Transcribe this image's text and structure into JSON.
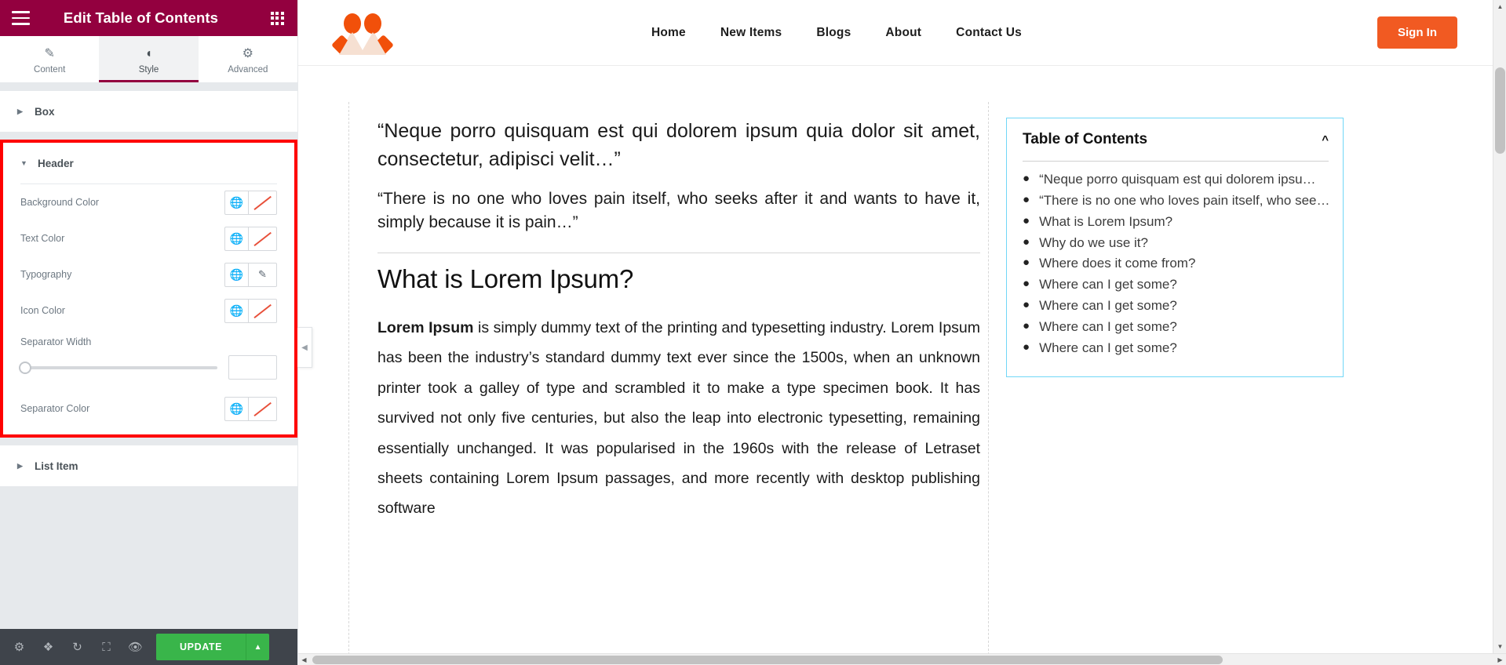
{
  "panel": {
    "title": "Edit Table of Contents",
    "menu_icon": "hamburger-icon",
    "grid_icon": "apps-grid-icon",
    "tabs": [
      {
        "label": "Content",
        "icon": "pencil-icon",
        "active": false
      },
      {
        "label": "Style",
        "icon": "contrast-icon",
        "active": true
      },
      {
        "label": "Advanced",
        "icon": "gear-icon",
        "active": false
      }
    ],
    "sections": [
      {
        "label": "Box",
        "expanded": false
      },
      {
        "label": "Header",
        "expanded": true
      },
      {
        "label": "List Item",
        "expanded": false
      }
    ],
    "header_controls": [
      {
        "label": "Background Color",
        "type": "color",
        "globe": "globe-icon",
        "swatch": "empty"
      },
      {
        "label": "Text Color",
        "type": "color",
        "globe": "globe-icon",
        "swatch": "empty"
      },
      {
        "label": "Typography",
        "type": "typography",
        "globe": "globe-icon",
        "swatch": "pencil"
      },
      {
        "label": "Icon Color",
        "type": "color",
        "globe": "globe-icon",
        "swatch": "empty"
      },
      {
        "label": "Separator Width",
        "type": "slider",
        "value": "",
        "slider_percent": 0
      },
      {
        "label": "Separator Color",
        "type": "color",
        "globe": "globe-icon",
        "swatch": "empty"
      }
    ],
    "footer": {
      "icons": [
        "gear-icon",
        "layers-icon",
        "history-icon",
        "responsive-icon",
        "preview-eye-icon"
      ],
      "update_label": "UPDATE",
      "update_caret": "chevron-up-icon"
    },
    "collapse_handle_icon": "chevron-left-icon",
    "highlight_color": "#ff0000",
    "header_bar_color": "#93003f"
  },
  "site": {
    "logo_alt": "site-logo",
    "nav": [
      "Home",
      "New Items",
      "Blogs",
      "About",
      "Contact Us"
    ],
    "signin_label": "Sign In",
    "accent_color": "#f15a22"
  },
  "article": {
    "quote1": "“Neque porro quisquam est qui dolorem ipsum quia dolor sit amet, consectetur, adipisci velit…”",
    "quote2": "“There is no one who loves pain itself, who seeks after it and wants to have it, simply because it is pain…”",
    "heading": "What is Lorem Ipsum?",
    "lead_bold": "Lorem Ipsum",
    "body": " is simply dummy text of the printing and typesetting industry. Lorem Ipsum has been the industry’s standard dummy text ever since the 1500s, when an unknown printer took a galley of type and scrambled it to make a type specimen book. It has survived not only five centuries, but also the leap into electronic typesetting, remaining essentially unchanged. It was popularised in the 1960s with the release of Letraset sheets containing Lorem Ipsum passages, and more recently with desktop publishing software"
  },
  "toc": {
    "title": "Table of Contents",
    "collapse_icon": "chevron-up-icon",
    "items": [
      "“Neque porro quisquam est qui dolorem ipsu…",
      "“There is no one who loves pain itself, who see…",
      "What is Lorem Ipsum?",
      "Why do we use it?",
      "Where does it come from?",
      "Where can I get some?",
      "Where can I get some?",
      "Where can I get some?",
      "Where can I get some?"
    ]
  }
}
